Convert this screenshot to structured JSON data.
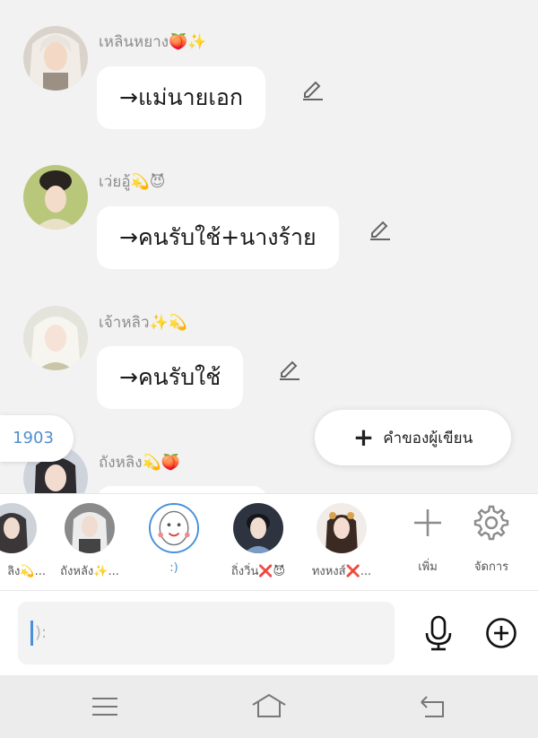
{
  "messages": [
    {
      "name": "เหลินหยาง🍑✨",
      "text": "→แม่นายเอก",
      "avatar": "long-white-hair-avatar"
    },
    {
      "name": "เว่ยอู้💫😈",
      "text": "→คนรับใช้+นางร้าย",
      "avatar": "black-hair-lady-avatar"
    },
    {
      "name": "เจ้าหลิว✨💫",
      "text": "→คนรับใช้",
      "avatar": "silver-hair-lady-avatar"
    },
    {
      "name": "ถังหลิง💫🍑",
      "text": "",
      "avatar": "dark-hair-man-avatar"
    }
  ],
  "floating": {
    "counter": "1903",
    "author_label": "คำของผู้เขียน",
    "author_plus": "+"
  },
  "characters": [
    {
      "label": "ลิง💫...",
      "avatar": "partial-avatar"
    },
    {
      "label": "ถังหลัง✨...",
      "avatar": "white-hair-avatar"
    },
    {
      "label": ":)",
      "avatar": "cartoon-face-avatar",
      "active": true
    },
    {
      "label": "ถิ่งวิ่น❌😈",
      "avatar": "blue-robe-avatar"
    },
    {
      "label": "ทงหงส์❌...",
      "avatar": "ornate-lady-avatar"
    }
  ],
  "tools": {
    "add_label": "เพิ่ม",
    "manage_label": "จัดการ"
  },
  "input": {
    "placeholder": "):"
  },
  "colors": {
    "accent": "#4a90d9",
    "background": "#f2f2f2"
  }
}
